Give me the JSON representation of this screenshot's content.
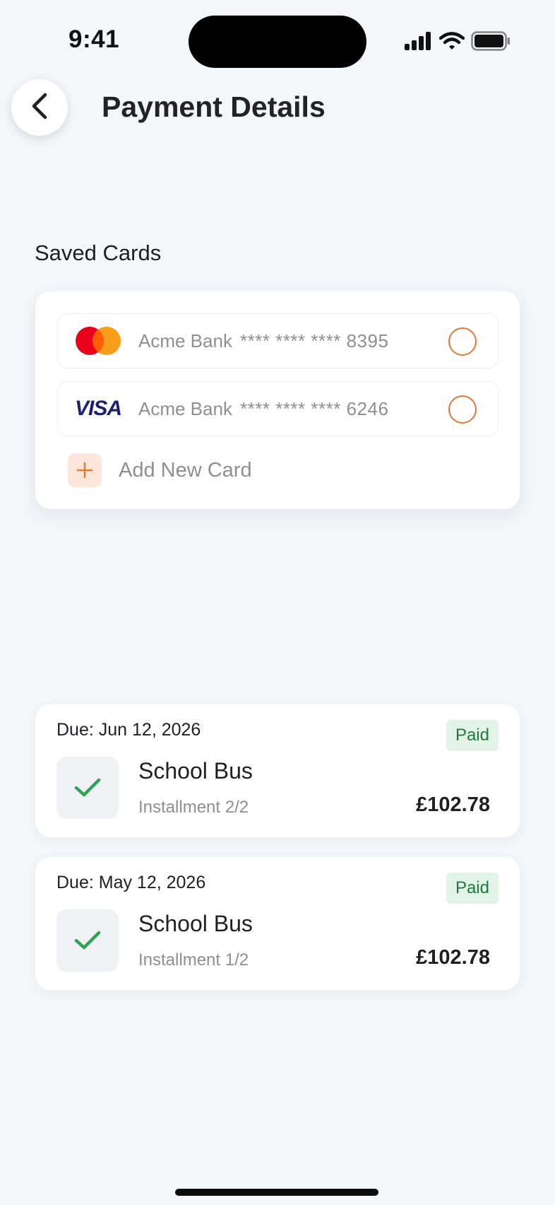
{
  "status_bar": {
    "time": "9:41"
  },
  "header": {
    "title": "Payment Details"
  },
  "saved_cards": {
    "title": "Saved Cards",
    "cards": [
      {
        "brand": "mastercard",
        "bank": "Acme Bank",
        "number": "**** **** **** 8395",
        "selected": false
      },
      {
        "brand": "visa",
        "bank": "Acme Bank",
        "number": "**** **** **** 6246",
        "selected": false
      }
    ],
    "visa_logo_text": "VISA",
    "add_label": "Add New Card"
  },
  "payments": [
    {
      "due": "Due: Jun 12, 2026",
      "status": "Paid",
      "title": "School Bus",
      "installment": "Installment 2/2",
      "amount": "£102.78"
    },
    {
      "due": "Due: May 12, 2026",
      "status": "Paid",
      "title": "School Bus",
      "installment": "Installment 1/2",
      "amount": "£102.78"
    }
  ],
  "colors": {
    "accent": "#E07A35",
    "paid_bg": "#E2F4E7",
    "paid_text": "#1C7A3A",
    "check": "#2EA356",
    "background": "#F4F6FA"
  }
}
